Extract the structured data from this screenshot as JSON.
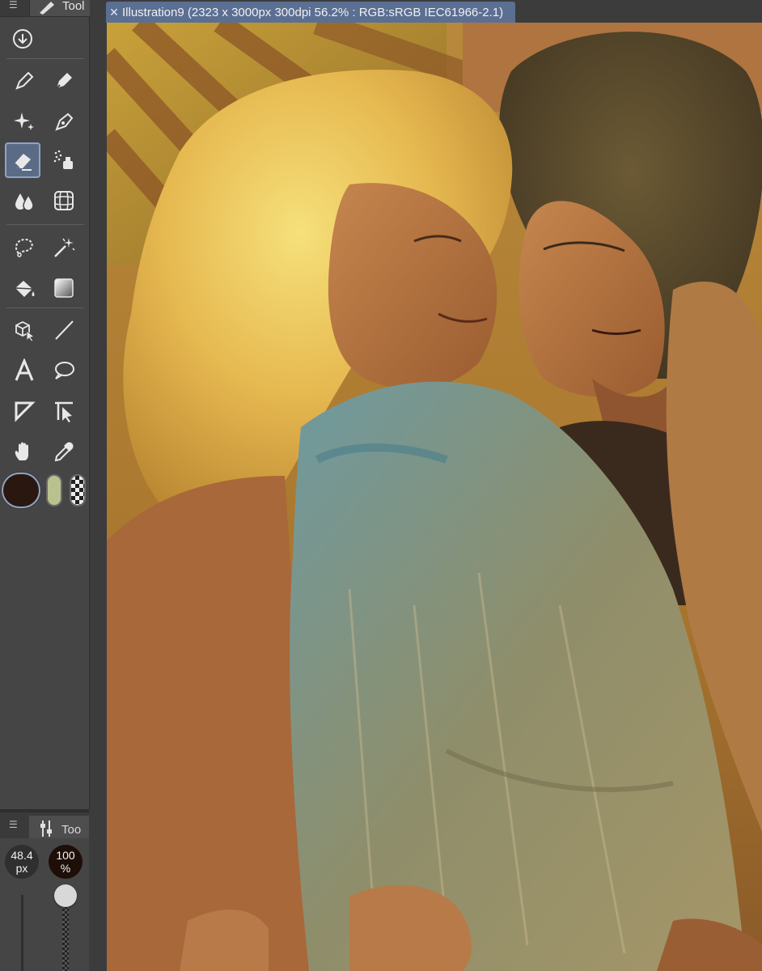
{
  "tool_palette": {
    "title": "Tool",
    "tools": [
      {
        "name": "navigate-download-icon",
        "label": "Download"
      },
      {
        "name": "pen-icon",
        "label": "Pen"
      },
      {
        "name": "pencil-icon",
        "label": "Pencil"
      },
      {
        "name": "sparkle-icon",
        "label": "Decoration"
      },
      {
        "name": "fountain-pen-icon",
        "label": "Brush"
      },
      {
        "name": "eraser-icon",
        "label": "Eraser",
        "selected": true
      },
      {
        "name": "airbrush-icon",
        "label": "Airbrush"
      },
      {
        "name": "blend-icon",
        "label": "Blend"
      },
      {
        "name": "mesh-icon",
        "label": "Mesh"
      },
      {
        "name": "lasso-icon",
        "label": "Lasso"
      },
      {
        "name": "magic-wand-icon",
        "label": "Auto select"
      },
      {
        "name": "fill-icon",
        "label": "Fill"
      },
      {
        "name": "gradient-icon",
        "label": "Gradient"
      },
      {
        "name": "object-icon",
        "label": "Object"
      },
      {
        "name": "line-icon",
        "label": "Figure"
      },
      {
        "name": "text-icon",
        "label": "Text"
      },
      {
        "name": "balloon-icon",
        "label": "Balloon"
      },
      {
        "name": "frame-icon",
        "label": "Frame border"
      },
      {
        "name": "ruler-icon",
        "label": "Ruler"
      },
      {
        "name": "hand-icon",
        "label": "Hand"
      },
      {
        "name": "eyedropper-icon",
        "label": "Eyedropper"
      }
    ],
    "colors": {
      "main": "#2a1810",
      "sub": "#b9c28f"
    }
  },
  "tool_property": {
    "title": "Too",
    "brush_size": "48.4",
    "brush_size_unit": "px",
    "opacity": "100",
    "opacity_unit": "%"
  },
  "document": {
    "tab_label": "Illustration9 (2323 x 3000px 300dpi 56.2% : RGB:sRGB IEC61966-2.1)"
  },
  "accent_color": "#5b6f93"
}
